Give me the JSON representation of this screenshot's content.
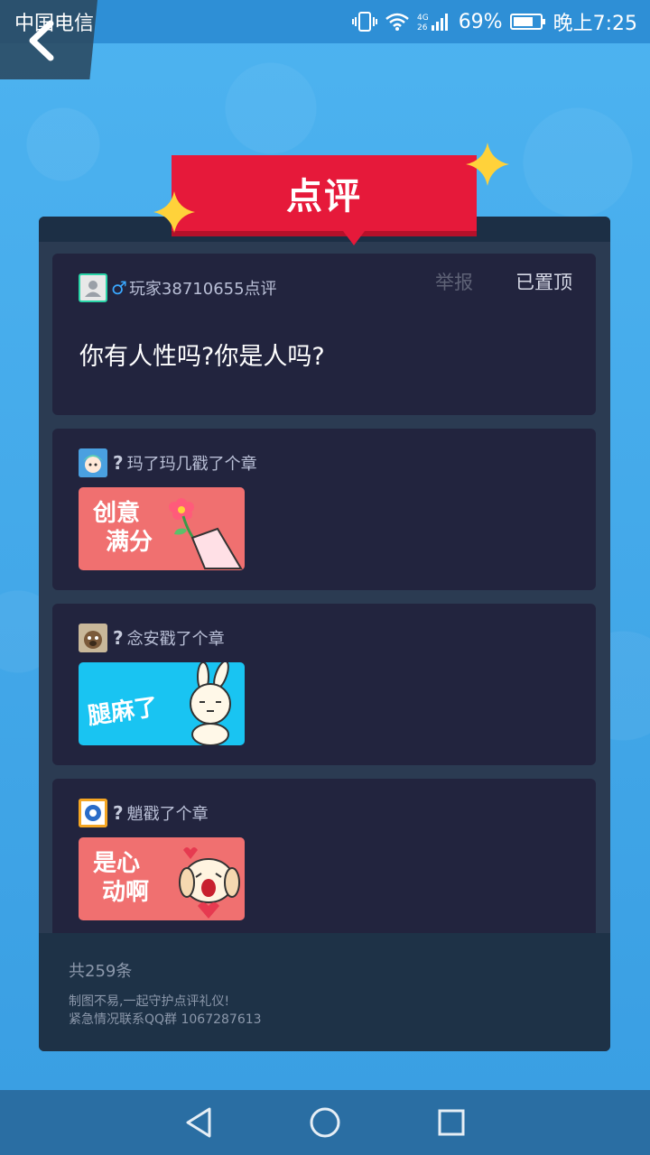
{
  "status_bar": {
    "carrier": "中国电信",
    "signal_label": "4G 26",
    "battery": "69%",
    "time": "晚上7:25"
  },
  "banner": {
    "title": "点评"
  },
  "pinned_review": {
    "author": "玩家38710655点评",
    "report_label": "举报",
    "pinned_label": "已置顶",
    "comment": "你有人性吗?你是人吗?"
  },
  "stamps": [
    {
      "user": "玛了玛几戳了个章",
      "sticker_text_line1": "创意",
      "sticker_text_line2": "满分",
      "color": "#f07070"
    },
    {
      "user": "念安戳了个章",
      "sticker_text_line1": "腿麻了",
      "sticker_text_line2": "",
      "color": "#19c4f2"
    },
    {
      "user": "魈戳了个章",
      "sticker_text_line1": "是心",
      "sticker_text_line2": "动啊",
      "color": "#f07070"
    }
  ],
  "footer": {
    "total": "共259条",
    "note_line1": "制图不易,一起守护点评礼仪!",
    "note_line2": "紧急情况联系QQ群 1067287613"
  },
  "icons": {
    "back": "chevron-left-icon",
    "nav_back": "triangle-back-icon",
    "nav_home": "circle-home-icon",
    "nav_recent": "square-recent-icon"
  }
}
